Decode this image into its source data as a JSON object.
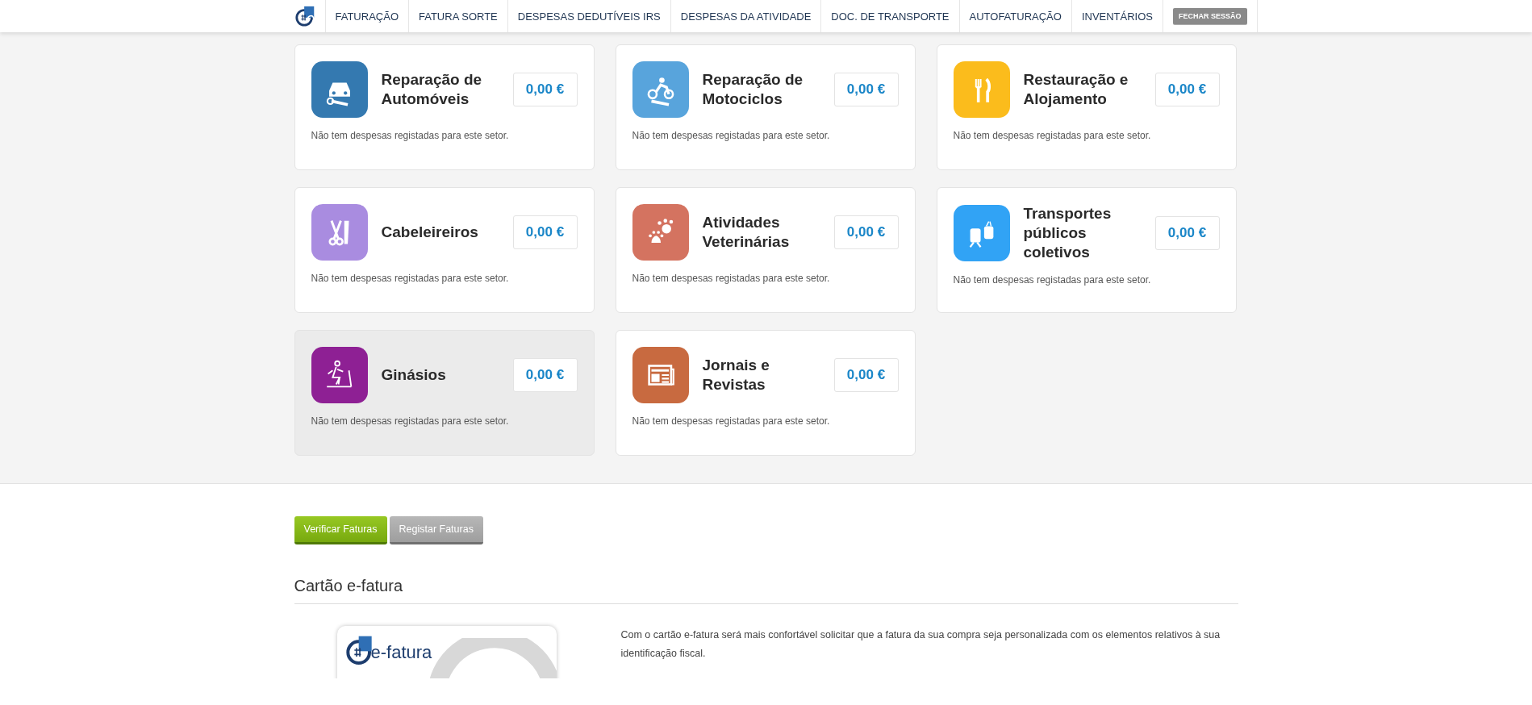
{
  "nav": {
    "items": [
      {
        "label": "FATURAÇÃO"
      },
      {
        "label": "FATURA SORTE"
      },
      {
        "label": "DESPESAS DEDUTÍVEIS IRS"
      },
      {
        "label": "DESPESAS DA ATIVIDADE"
      },
      {
        "label": "DOC. DE TRANSPORTE"
      },
      {
        "label": "AUTOFATURAÇÃO"
      },
      {
        "label": "INVENTÁRIOS"
      }
    ],
    "logout": {
      "label": "FECHAR SESSÃO",
      "disabled": true
    }
  },
  "sectors": [
    {
      "title": "Reparação de Automóveis",
      "amount": "0,00 €",
      "message": "Não tem despesas registadas para este setor.",
      "color": "#3479b0",
      "highlighted": false
    },
    {
      "title": "Reparação de Motociclos",
      "amount": "0,00 €",
      "message": "Não tem despesas registadas para este setor.",
      "color": "#58a4dc",
      "highlighted": false
    },
    {
      "title": "Restauração e Alojamento",
      "amount": "0,00 €",
      "message": "Não tem despesas registadas para este setor.",
      "color": "#fbbc1c",
      "highlighted": false
    },
    {
      "title": "Cabeleireiros",
      "amount": "0,00 €",
      "message": "Não tem despesas registadas para este setor.",
      "color": "#a98ce0",
      "highlighted": false
    },
    {
      "title": "Atividades Veterinárias",
      "amount": "0,00 €",
      "message": "Não tem despesas registadas para este setor.",
      "color": "#d47360",
      "highlighted": false
    },
    {
      "title": "Transportes públicos coletivos",
      "amount": "0,00 €",
      "message": "Não tem despesas registadas para este setor.",
      "color": "#31a3f5",
      "highlighted": false
    },
    {
      "title": "Ginásios",
      "amount": "0,00 €",
      "message": "Não tem despesas registadas para este setor.",
      "color": "#8e2094",
      "highlighted": true
    },
    {
      "title": "Jornais e Revistas",
      "amount": "0,00 €",
      "message": "Não tem despesas registadas para este setor.",
      "color": "#c86a40",
      "highlighted": false
    }
  ],
  "actions": [
    {
      "label": "Verificar Faturas",
      "kind": "primary"
    },
    {
      "label": "Registar Faturas",
      "kind": "secondary"
    }
  ],
  "card_section": {
    "heading": "Cartão e-fatura",
    "card_logo": "e-fatura",
    "text": "Com o cartão e-fatura será mais confortável solicitar que a fatura da sua compra seja personalizada com os elementos relativos à sua identificação fiscal."
  }
}
